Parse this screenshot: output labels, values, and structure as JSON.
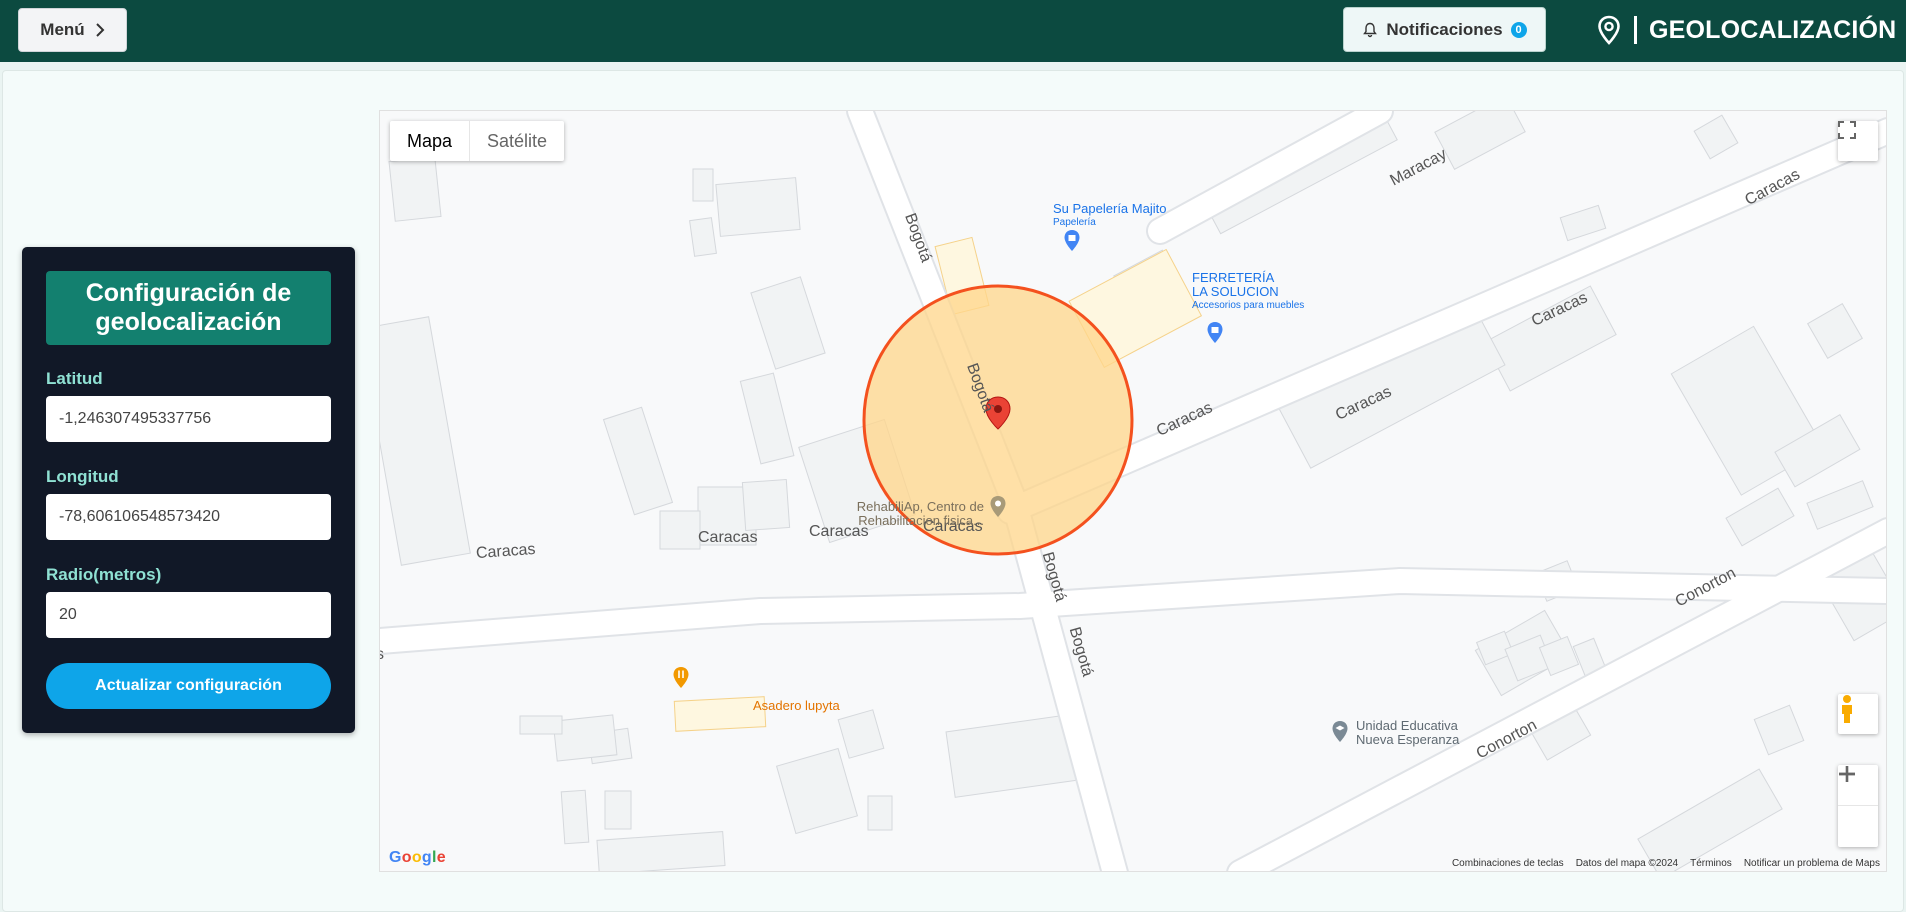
{
  "topbar": {
    "menu_label": "Menú",
    "notifications_label": "Notificaciones",
    "notifications_count": "0",
    "brand_title": "GEOLOCALIZACIÓN"
  },
  "config": {
    "title": "Configuración de geolocalización",
    "lat_label": "Latitud",
    "lat_value": "-1,246307495337756",
    "lng_label": "Longitud",
    "lng_value": "-78,606106548573420",
    "radius_label": "Radio(metros)",
    "radius_value": "20",
    "update_label": "Actualizar configuración"
  },
  "map": {
    "type_options": [
      "Mapa",
      "Satélite"
    ],
    "active_type": "Mapa",
    "streets": [
      "Maracay",
      "Caracas",
      "Caracas",
      "Caracas",
      "Caracas",
      "Caracas",
      "Caracas",
      "Caracas",
      "Caracas",
      "Bogotá",
      "Bogotá",
      "Bogotá",
      "Bogotá",
      "Conorton",
      "Conorton",
      "s"
    ],
    "pois": {
      "papeleria_name": "Su Papelería Majito",
      "papeleria_type": "Papelería",
      "ferreteria_name_1": "FERRETERÍA",
      "ferreteria_name_2": "LA SOLUCION",
      "ferreteria_type": "Accesorios para muebles",
      "rehab_1": "RehabiliAp, Centro de",
      "rehab_2": "Rehabilitacion fisica...",
      "asadero": "Asadero lupyta",
      "escuela_1": "Unidad Educativa",
      "escuela_2": "Nueva Esperanza"
    },
    "logo": "Google",
    "attribution": [
      "Combinaciones de teclas",
      "Datos del mapa ©2024",
      "Términos",
      "Notificar un problema de Maps"
    ],
    "circle_color": "#f4511e",
    "circle_fill": "#ffd58a",
    "marker_color": "#ea4335"
  },
  "colors": {
    "topbar": "#0c4a40",
    "panel": "#111827",
    "accent": "#13806f",
    "button": "#0ea5e9"
  }
}
